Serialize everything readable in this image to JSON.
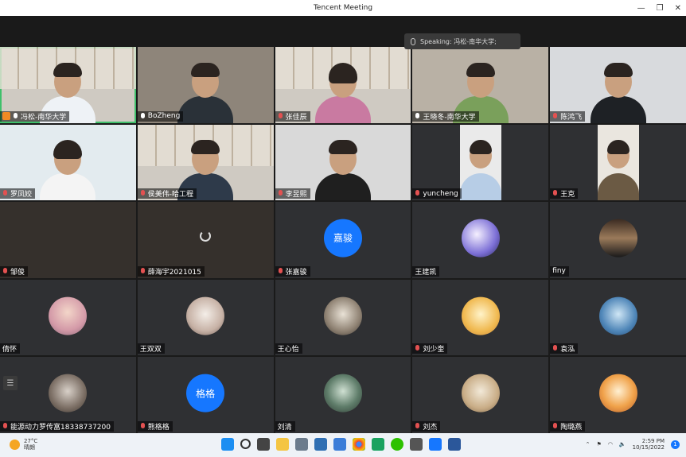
{
  "window": {
    "title": "Tencent Meeting"
  },
  "speaking_banner": {
    "label": "Speaking: 冯松-南华大学;"
  },
  "participants": [
    {
      "name": "冯松-南华大学",
      "mic": "on",
      "host": true,
      "type": "video"
    },
    {
      "name": "BoZheng",
      "mic": "on",
      "type": "video"
    },
    {
      "name": "张佳辰",
      "mic": "muted",
      "type": "video"
    },
    {
      "name": "王晓冬-南华大学",
      "mic": "on",
      "type": "video"
    },
    {
      "name": "陈鸿飞",
      "mic": "muted",
      "type": "video"
    },
    {
      "name": "罗凤姣",
      "mic": "muted",
      "type": "video"
    },
    {
      "name": "侯美伟-哈工程",
      "mic": "muted",
      "type": "video"
    },
    {
      "name": "李昱熙",
      "mic": "muted",
      "type": "video"
    },
    {
      "name": "yuncheng",
      "mic": "muted",
      "type": "video"
    },
    {
      "name": "王克",
      "mic": "muted",
      "type": "video"
    },
    {
      "name": "邹俊",
      "mic": "muted",
      "type": "empty"
    },
    {
      "name": "薛海宇2021015",
      "mic": "muted",
      "type": "loading"
    },
    {
      "name": "张嘉骏",
      "mic": "muted",
      "type": "avatar-text",
      "avatar_text": "嘉骏"
    },
    {
      "name": "王建凯",
      "type": "avatar"
    },
    {
      "name": "finy",
      "type": "avatar"
    },
    {
      "name": "倩怀",
      "type": "avatar"
    },
    {
      "name": "王双双",
      "type": "avatar"
    },
    {
      "name": "王心怡",
      "type": "avatar"
    },
    {
      "name": "刘少奎",
      "mic": "muted",
      "type": "avatar"
    },
    {
      "name": "袁泓",
      "mic": "muted",
      "type": "avatar"
    },
    {
      "name": "能源动力罗传富18338737200",
      "mic": "muted",
      "type": "avatar"
    },
    {
      "name": "熊格格",
      "mic": "muted",
      "type": "avatar-text",
      "avatar_text": "格格"
    },
    {
      "name": "刘清",
      "type": "avatar"
    },
    {
      "name": "刘杰",
      "mic": "muted",
      "type": "avatar"
    },
    {
      "name": "陶璐燕",
      "mic": "muted",
      "type": "avatar"
    }
  ],
  "taskbar": {
    "weather_temp": "27°C",
    "weather_desc": "晴朗",
    "time": "2:59 PM",
    "date": "10/15/2022",
    "notification_count": "1"
  },
  "colors": {
    "accent": "#1677ff",
    "active_border": "#3fc06b",
    "muted": "#e35151"
  }
}
